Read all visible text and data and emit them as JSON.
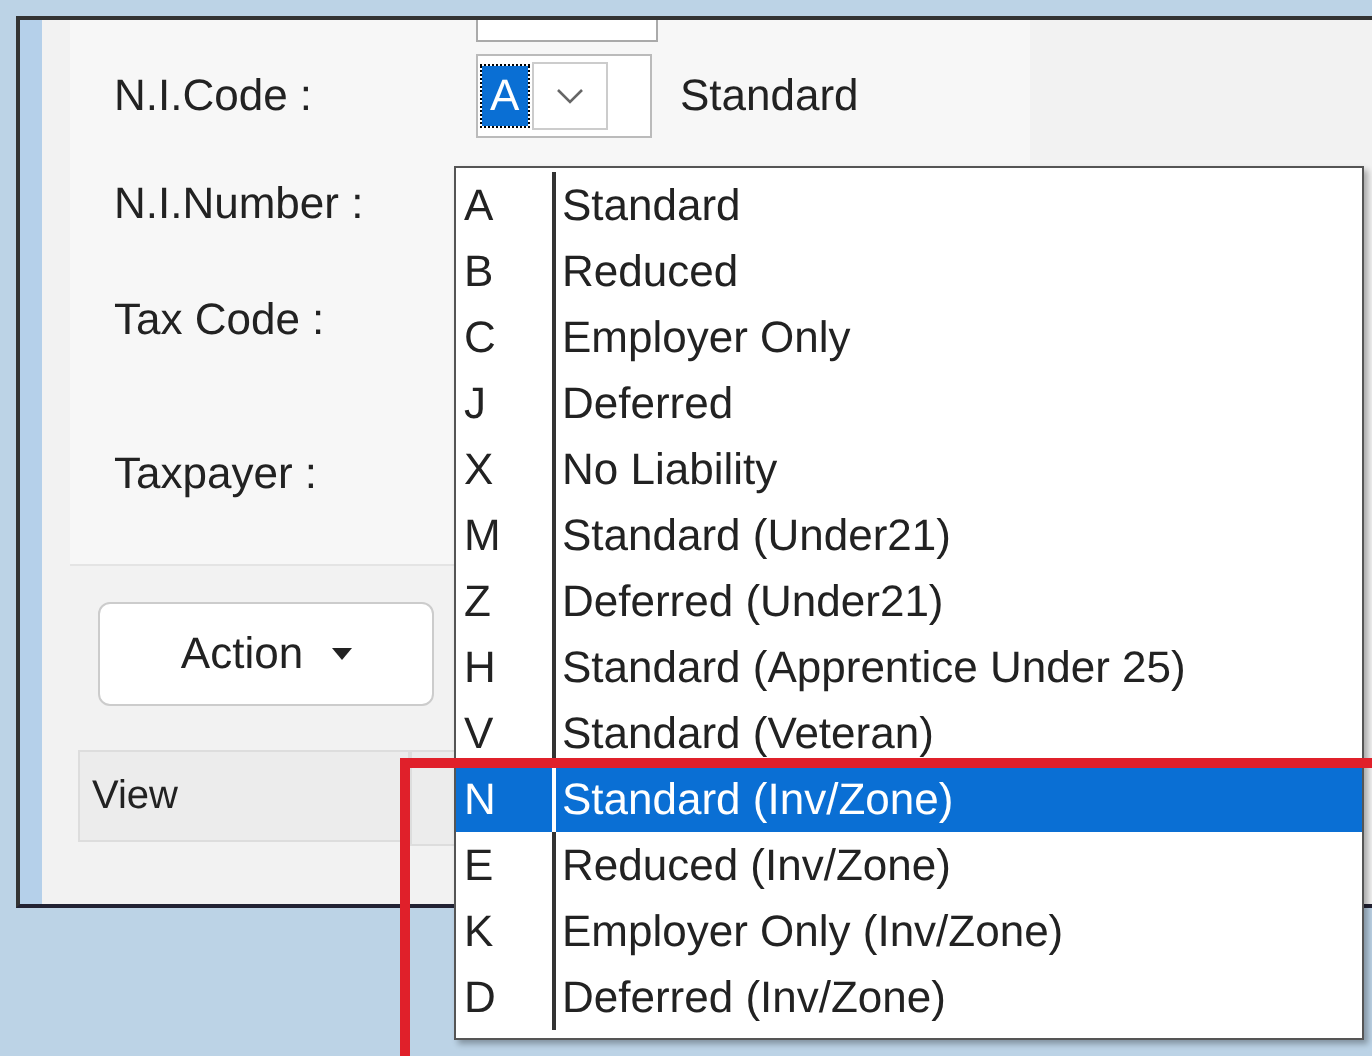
{
  "fields": [
    {
      "label": "N.I.Code :"
    },
    {
      "label": "N.I.Number :"
    },
    {
      "label": "Tax Code :"
    },
    {
      "label": "Taxpayer :"
    }
  ],
  "ni_code": {
    "value": "A",
    "description": "Standard"
  },
  "dropdown": {
    "items": [
      {
        "code": "A",
        "name": "Standard",
        "selected": false
      },
      {
        "code": "B",
        "name": "Reduced",
        "selected": false
      },
      {
        "code": "C",
        "name": "Employer Only",
        "selected": false
      },
      {
        "code": "J",
        "name": "Deferred",
        "selected": false
      },
      {
        "code": "X",
        "name": "No Liability",
        "selected": false
      },
      {
        "code": "M",
        "name": "Standard (Under21)",
        "selected": false
      },
      {
        "code": "Z",
        "name": "Deferred (Under21)",
        "selected": false
      },
      {
        "code": "H",
        "name": "Standard (Apprentice Under 25)",
        "selected": false
      },
      {
        "code": "V",
        "name": "Standard (Veteran)",
        "selected": false
      },
      {
        "code": "N",
        "name": "Standard (Inv/Zone)",
        "selected": true
      },
      {
        "code": "E",
        "name": "Reduced (Inv/Zone)",
        "selected": false
      },
      {
        "code": "K",
        "name": "Employer Only (Inv/Zone)",
        "selected": false
      },
      {
        "code": "D",
        "name": "Deferred (Inv/Zone)",
        "selected": false
      }
    ]
  },
  "action_button": {
    "label": "Action"
  },
  "tabs": [
    {
      "label": "View"
    }
  ]
}
